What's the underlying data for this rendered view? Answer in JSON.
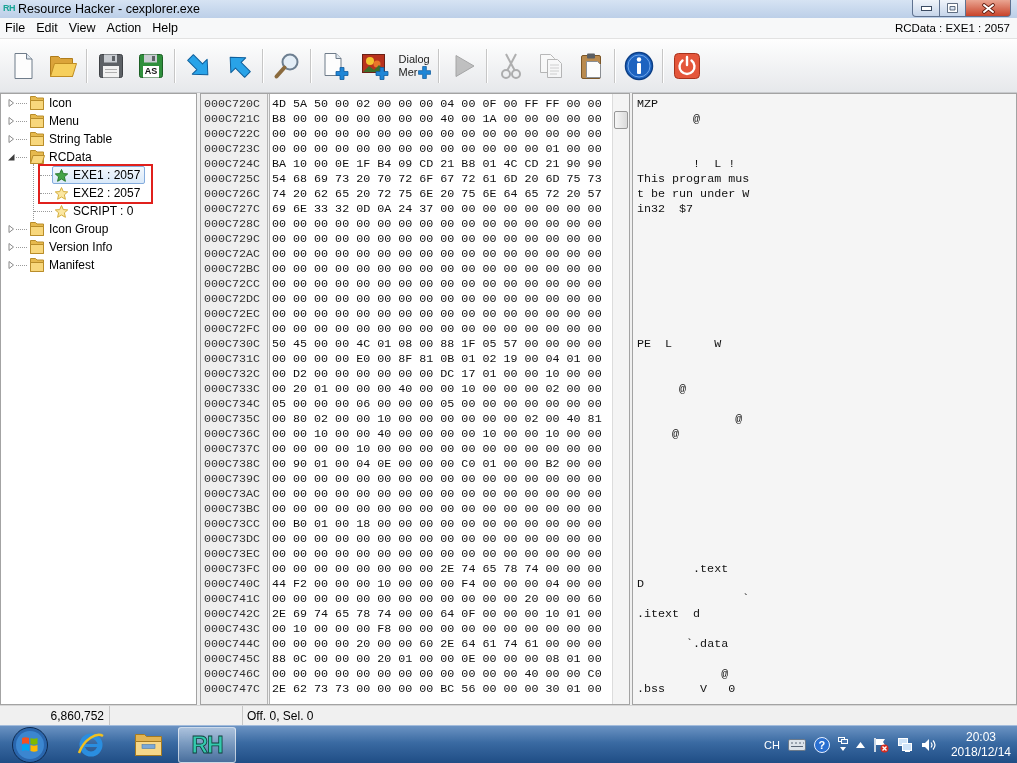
{
  "window": {
    "logo": "RH",
    "title": "Resource Hacker - cexplorer.exe",
    "controls": [
      {
        "kind": "minimize"
      },
      {
        "kind": "maximize"
      },
      {
        "kind": "close"
      }
    ]
  },
  "menu": {
    "items": [
      "File",
      "Edit",
      "View",
      "Action",
      "Help"
    ],
    "path": "RCData : EXE1 : 2057"
  },
  "toolbar": {
    "groups": [
      [
        {
          "kind": "new",
          "disabled": false
        },
        {
          "kind": "open",
          "disabled": false
        }
      ],
      [
        {
          "kind": "save",
          "disabled": false
        },
        {
          "kind": "save_as",
          "label": "AS",
          "disabled": false
        }
      ],
      [
        {
          "kind": "import",
          "disabled": false
        },
        {
          "kind": "export",
          "disabled": false
        }
      ],
      [
        {
          "kind": "find",
          "disabled": false
        }
      ],
      [
        {
          "kind": "add",
          "disabled": false
        },
        {
          "kind": "add_image",
          "disabled": false
        },
        {
          "kind": "dialog_merge",
          "lines": [
            "Dialog",
            "Mer"
          ],
          "disabled": false
        }
      ],
      [
        {
          "kind": "run",
          "disabled": true
        }
      ],
      [
        {
          "kind": "cut",
          "disabled": true
        },
        {
          "kind": "copy",
          "disabled": true
        },
        {
          "kind": "paste",
          "disabled": false
        }
      ],
      [
        {
          "kind": "about",
          "disabled": false
        }
      ],
      [
        {
          "kind": "exit",
          "disabled": false
        }
      ]
    ]
  },
  "tree": {
    "items": [
      {
        "label": "Icon",
        "expanded": false,
        "selected": false
      },
      {
        "label": "Menu",
        "expanded": false,
        "selected": false
      },
      {
        "label": "String Table",
        "expanded": false,
        "selected": false
      },
      {
        "label": "RCData",
        "expanded": true,
        "selected": false,
        "children": [
          {
            "label": "EXE1 : 2057",
            "selected": true,
            "marked": true
          },
          {
            "label": "EXE2 : 2057",
            "selected": false,
            "marked": true
          },
          {
            "label": "SCRIPT : 0",
            "selected": false,
            "marked": false
          }
        ]
      },
      {
        "label": "Icon Group",
        "expanded": false,
        "selected": false
      },
      {
        "label": "Version Info",
        "expanded": false,
        "selected": false
      },
      {
        "label": "Manifest",
        "expanded": false,
        "selected": false
      }
    ]
  },
  "hex_view": {
    "rows": [
      {
        "offset": "000C720C",
        "bytes": "4D 5A 50 00 02 00 00 00 04 00 0F 00 FF FF 00 00",
        "text": "MZP"
      },
      {
        "offset": "000C721C",
        "bytes": "B8 00 00 00 00 00 00 00 40 00 1A 00 00 00 00 00",
        "text": "        @"
      },
      {
        "offset": "000C722C",
        "bytes": "00 00 00 00 00 00 00 00 00 00 00 00 00 00 00 00"
      },
      {
        "offset": "000C723C",
        "bytes": "00 00 00 00 00 00 00 00 00 00 00 00 00 01 00 00"
      },
      {
        "offset": "000C724C",
        "bytes": "BA 10 00 0E 1F B4 09 CD 21 B8 01 4C CD 21 90 90",
        "text": "        !  L !"
      },
      {
        "offset": "000C725C",
        "bytes": "54 68 69 73 20 70 72 6F 67 72 61 6D 20 6D 75 73",
        "text": "This program mus"
      },
      {
        "offset": "000C726C",
        "bytes": "74 20 62 65 20 72 75 6E 20 75 6E 64 65 72 20 57",
        "text": "t be run under W"
      },
      {
        "offset": "000C727C",
        "bytes": "69 6E 33 32 0D 0A 24 37 00 00 00 00 00 00 00 00",
        "text": "in32  $7"
      },
      {
        "offset": "000C728C",
        "bytes": "00 00 00 00 00 00 00 00 00 00 00 00 00 00 00 00"
      },
      {
        "offset": "000C729C",
        "bytes": "00 00 00 00 00 00 00 00 00 00 00 00 00 00 00 00"
      },
      {
        "offset": "000C72AC",
        "bytes": "00 00 00 00 00 00 00 00 00 00 00 00 00 00 00 00"
      },
      {
        "offset": "000C72BC",
        "bytes": "00 00 00 00 00 00 00 00 00 00 00 00 00 00 00 00"
      },
      {
        "offset": "000C72CC",
        "bytes": "00 00 00 00 00 00 00 00 00 00 00 00 00 00 00 00"
      },
      {
        "offset": "000C72DC",
        "bytes": "00 00 00 00 00 00 00 00 00 00 00 00 00 00 00 00"
      },
      {
        "offset": "000C72EC",
        "bytes": "00 00 00 00 00 00 00 00 00 00 00 00 00 00 00 00"
      },
      {
        "offset": "000C72FC",
        "bytes": "00 00 00 00 00 00 00 00 00 00 00 00 00 00 00 00"
      },
      {
        "offset": "000C730C",
        "bytes": "50 45 00 00 4C 01 08 00 88 1F 05 57 00 00 00 00",
        "text": "PE  L      W"
      },
      {
        "offset": "000C731C",
        "bytes": "00 00 00 00 E0 00 8F 81 0B 01 02 19 00 04 01 00"
      },
      {
        "offset": "000C732C",
        "bytes": "00 D2 00 00 00 00 00 00 DC 17 01 00 00 10 00 00"
      },
      {
        "offset": "000C733C",
        "bytes": "00 20 01 00 00 00 40 00 00 10 00 00 00 02 00 00",
        "text": "      @"
      },
      {
        "offset": "000C734C",
        "bytes": "05 00 00 00 06 00 00 00 05 00 00 00 00 00 00 00"
      },
      {
        "offset": "000C735C",
        "bytes": "00 80 02 00 00 10 00 00 00 00 00 00 02 00 40 81",
        "text": "              @"
      },
      {
        "offset": "000C736C",
        "bytes": "00 00 10 00 00 40 00 00 00 00 10 00 00 10 00 00",
        "text": "     @"
      },
      {
        "offset": "000C737C",
        "bytes": "00 00 00 00 10 00 00 00 00 00 00 00 00 00 00 00"
      },
      {
        "offset": "000C738C",
        "bytes": "00 90 01 00 04 0E 00 00 00 C0 01 00 00 B2 00 00"
      },
      {
        "offset": "000C739C",
        "bytes": "00 00 00 00 00 00 00 00 00 00 00 00 00 00 00 00"
      },
      {
        "offset": "000C73AC",
        "bytes": "00 00 00 00 00 00 00 00 00 00 00 00 00 00 00 00"
      },
      {
        "offset": "000C73BC",
        "bytes": "00 00 00 00 00 00 00 00 00 00 00 00 00 00 00 00"
      },
      {
        "offset": "000C73CC",
        "bytes": "00 B0 01 00 18 00 00 00 00 00 00 00 00 00 00 00"
      },
      {
        "offset": "000C73DC",
        "bytes": "00 00 00 00 00 00 00 00 00 00 00 00 00 00 00 00"
      },
      {
        "offset": "000C73EC",
        "bytes": "00 00 00 00 00 00 00 00 00 00 00 00 00 00 00 00"
      },
      {
        "offset": "000C73FC",
        "bytes": "00 00 00 00 00 00 00 00 2E 74 65 78 74 00 00 00",
        "text": "        .text"
      },
      {
        "offset": "000C740C",
        "bytes": "44 F2 00 00 00 10 00 00 00 F4 00 00 00 04 00 00",
        "text": "D"
      },
      {
        "offset": "000C741C",
        "bytes": "00 00 00 00 00 00 00 00 00 00 00 00 20 00 00 60",
        "text": "               `"
      },
      {
        "offset": "000C742C",
        "bytes": "2E 69 74 65 78 74 00 00 64 0F 00 00 00 10 01 00",
        "text": ".itext  d"
      },
      {
        "offset": "000C743C",
        "bytes": "00 10 00 00 00 F8 00 00 00 00 00 00 00 00 00 00"
      },
      {
        "offset": "000C744C",
        "bytes": "00 00 00 00 20 00 00 60 2E 64 61 74 61 00 00 00",
        "text": "       `.data"
      },
      {
        "offset": "000C745C",
        "bytes": "88 0C 00 00 00 20 01 00 00 0E 00 00 00 08 01 00"
      },
      {
        "offset": "000C746C",
        "bytes": "00 00 00 00 00 00 00 00 00 00 00 00 40 00 00 C0",
        "text": "            @"
      },
      {
        "offset": "000C747C",
        "bytes": "2E 62 73 73 00 00 00 00 BC 56 00 00 00 30 01 00",
        "text": ".bss     V   0"
      }
    ]
  },
  "status_bar": {
    "size": "6,860,752",
    "position": "Off. 0, Sel. 0"
  },
  "taskbar": {
    "apps": [
      {
        "kind": "browser",
        "selected": false
      },
      {
        "kind": "explorer",
        "selected": false
      },
      {
        "kind": "app",
        "label": "RH",
        "selected": true
      }
    ],
    "tray": [
      {
        "kind": "language",
        "label": "CH"
      },
      {
        "kind": "keyboard"
      },
      {
        "kind": "help",
        "label": "?"
      },
      {
        "kind": "windows"
      },
      {
        "kind": "arrow"
      },
      {
        "kind": "flag"
      },
      {
        "kind": "network"
      },
      {
        "kind": "volume"
      }
    ],
    "time": "20:03",
    "date": "2018/12/14"
  }
}
